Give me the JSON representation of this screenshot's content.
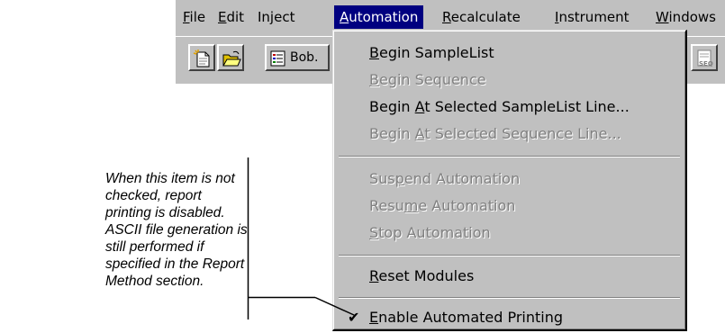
{
  "menubar": {
    "items": [
      {
        "label_ul": "F",
        "label_rest": "ile"
      },
      {
        "label_ul": "E",
        "label_rest": "dit"
      },
      {
        "label_ul": "",
        "label_rest": "Inject"
      },
      {
        "label_ul": "A",
        "label_rest": "utomation"
      },
      {
        "label_ul": "R",
        "label_rest": "ecalculate"
      },
      {
        "label_ul": "I",
        "label_rest": "nstrument"
      },
      {
        "label_ul": "W",
        "label_rest": "indows"
      }
    ]
  },
  "toolbar": {
    "icons": [
      "new-document-icon",
      "open-folder-icon",
      "sample-list-icon",
      "sequence-icon"
    ],
    "sample_list_button_label": "Bob."
  },
  "automation_menu": {
    "items": [
      {
        "pre": "",
        "ul": "B",
        "post": "egin SampleList",
        "enabled": true
      },
      {
        "pre": "",
        "ul": "B",
        "post": "egin Sequence",
        "enabled": false
      },
      {
        "pre": "Begin ",
        "ul": "A",
        "post": "t Selected SampleList Line...",
        "enabled": true
      },
      {
        "pre": "Begin ",
        "ul": "A",
        "post": "t Selected Sequence Line...",
        "enabled": false
      },
      {
        "pre": "Sus",
        "ul": "p",
        "post": "end Automation",
        "enabled": false
      },
      {
        "pre": "Resu",
        "ul": "m",
        "post": "e Automation",
        "enabled": false
      },
      {
        "pre": "",
        "ul": "S",
        "post": "top Automation",
        "enabled": false
      },
      {
        "pre": "",
        "ul": "R",
        "post": "eset Modules",
        "enabled": true
      },
      {
        "pre": "",
        "ul": "E",
        "post": "nable Automated Printing",
        "enabled": true,
        "checked": true
      }
    ],
    "check_mark": "✔"
  },
  "annotation": {
    "text": "When this item is not checked, report printing is disabled.  ASCII file generation is still performed if specified in the Report Method section."
  },
  "colors": {
    "menu_face": "#c0c0c0",
    "highlight": "#000080",
    "disabled_text": "#808080"
  }
}
